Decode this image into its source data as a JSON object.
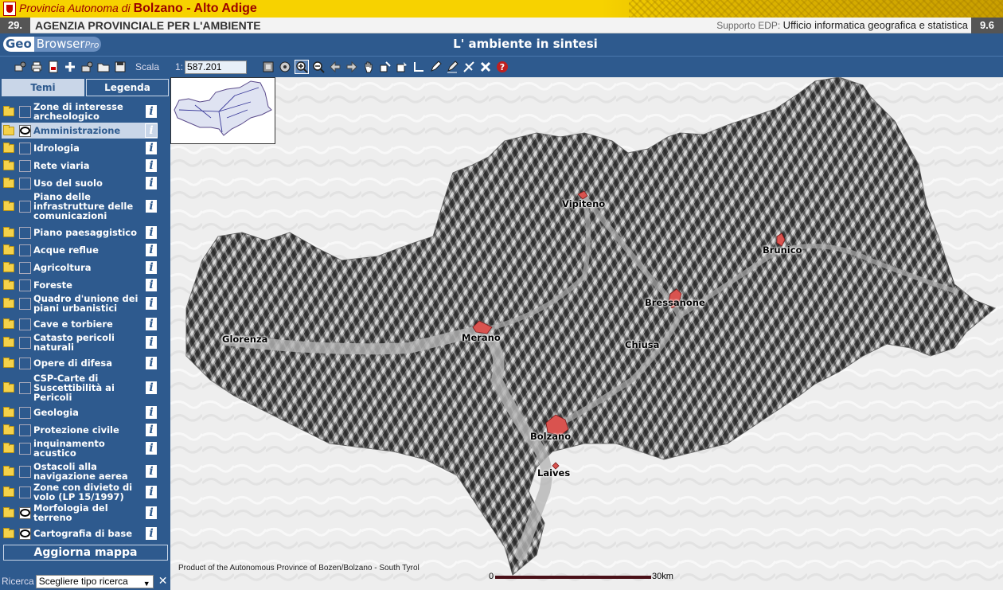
{
  "header": {
    "province_prefix": "Provincia Autonoma di",
    "province_name": "Bolzano - Alto Adige",
    "agency_number": "29.",
    "agency_name": "AGENZIA PROVINCIALE PER L'AMBIENTE",
    "support_label": "Supporto EDP:",
    "support_value": "Ufficio informatica geografica e statistica",
    "version": "9.6"
  },
  "app": {
    "logo_geo": "Geo",
    "logo_browser": "Browser",
    "logo_pro": "Pro",
    "title": "L' ambiente in sintesi"
  },
  "toolbar": {
    "scale_label": "Scala",
    "scale_prefix": "1:",
    "scale_value": "587.201"
  },
  "tabs": {
    "themes": "Temi",
    "legend": "Legenda"
  },
  "layers": [
    {
      "label": "Zone di interesse archeologico",
      "visible": false
    },
    {
      "label": "Amministrazione",
      "visible": true,
      "selected": true
    },
    {
      "label": "Idrologia",
      "visible": false
    },
    {
      "label": "Rete viaria",
      "visible": false
    },
    {
      "label": "Uso del suolo",
      "visible": false
    },
    {
      "label": "Piano delle infrastrutture delle comunicazioni",
      "visible": false
    },
    {
      "label": "Piano paesaggistico",
      "visible": false
    },
    {
      "label": "Acque reflue",
      "visible": false
    },
    {
      "label": "Agricoltura",
      "visible": false
    },
    {
      "label": "Foreste",
      "visible": false
    },
    {
      "label": "Quadro d'unione dei piani urbanistici",
      "visible": false
    },
    {
      "label": "Cave e torbiere",
      "visible": false
    },
    {
      "label": "Catasto pericoli naturali",
      "visible": false
    },
    {
      "label": "Opere di difesa",
      "visible": false
    },
    {
      "label": "CSP-Carte di Suscettibilità ai Pericoli",
      "visible": false
    },
    {
      "label": "Geologia",
      "visible": false
    },
    {
      "label": "Protezione civile",
      "visible": false
    },
    {
      "label": "inquinamento acustico",
      "visible": false
    },
    {
      "label": "Ostacoli alla navigazione aerea",
      "visible": false
    },
    {
      "label": "Zone con divieto di volo (LP 15/1997)",
      "visible": false
    },
    {
      "label": "Morfologia del terreno",
      "visible": true
    },
    {
      "label": "Cartografia di base",
      "visible": true
    }
  ],
  "update_button": "Aggiorna mappa",
  "search": {
    "label": "Ricerca",
    "selected": "Scegliere tipo ricerca"
  },
  "map": {
    "cities": [
      "Vipiteno",
      "Brunico",
      "Bressanone",
      "Glorenza",
      "Merano",
      "Chiusa",
      "Bolzano",
      "Laives"
    ],
    "copyright": "Product of the Autonomous Province of Bozen/Bolzano - South Tyrol",
    "scale_start": "0",
    "scale_end": "30km",
    "settlement_color": "#d9534f"
  }
}
